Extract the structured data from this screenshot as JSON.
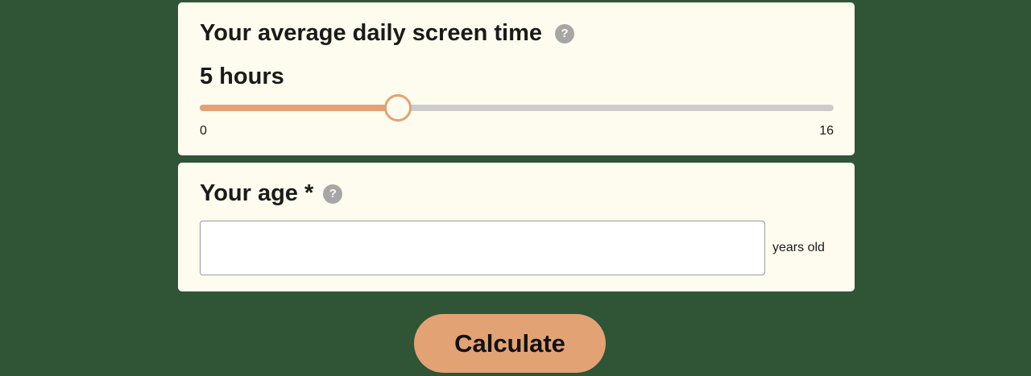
{
  "screen_time": {
    "question": "Your average daily screen time",
    "help_icon": "question-mark-icon",
    "value_label": "5 hours",
    "slider": {
      "min": 0,
      "max": 16,
      "value": 5,
      "min_label": "0",
      "max_label": "16"
    }
  },
  "age": {
    "question": "Your age *",
    "help_icon": "question-mark-icon",
    "input_value": "",
    "placeholder": "",
    "unit": "years old"
  },
  "calculate_button": {
    "label": "Calculate"
  },
  "colors": {
    "background": "#2f5436",
    "card": "#fefcee",
    "accent": "#e3a274",
    "track": "#cccccc",
    "help_icon": "#a6a6a6"
  }
}
